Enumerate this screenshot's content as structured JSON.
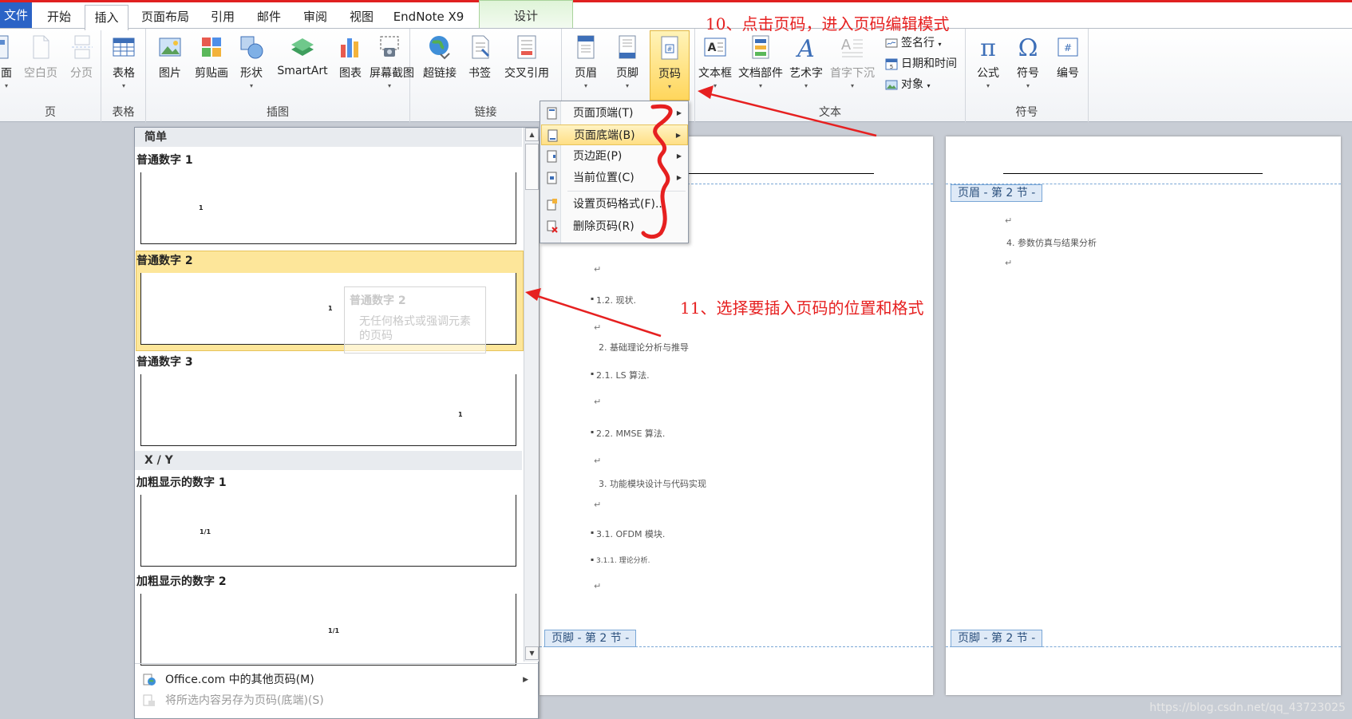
{
  "tabs": [
    {
      "label": "文件"
    },
    {
      "label": "开始"
    },
    {
      "label": "插入"
    },
    {
      "label": "页面布局"
    },
    {
      "label": "引用"
    },
    {
      "label": "邮件"
    },
    {
      "label": "审阅"
    },
    {
      "label": "视图"
    },
    {
      "label": "EndNote X9"
    },
    {
      "label": "设计"
    }
  ],
  "ribbon": {
    "groups": {
      "pages": "页",
      "tables": "表格",
      "illustrations": "插图",
      "links": "链接",
      "text": "文本",
      "symbols": "符号"
    },
    "buttons": {
      "cover": "面",
      "blank_page": "空白页",
      "page_break": "分页",
      "table": "表格",
      "picture": "图片",
      "clipart": "剪贴画",
      "shapes": "形状",
      "smartart": "SmartArt",
      "chart": "图表",
      "screenshot": "屏幕截图",
      "hyperlink": "超链接",
      "bookmark": "书签",
      "cross_ref": "交叉引用",
      "header": "页眉",
      "footer": "页脚",
      "page_number": "页码",
      "textbox": "文本框",
      "quick_parts": "文档部件",
      "wordart": "艺术字",
      "dropcap": "首字下沉",
      "signature": "签名行",
      "datetime": "日期和时间",
      "object": "对象",
      "equation": "公式",
      "symbol": "符号",
      "numbering": "编号"
    }
  },
  "menu": {
    "items": [
      {
        "label": "页面顶端(T)"
      },
      {
        "label": "页面底端(B)"
      },
      {
        "label": "页边距(P)"
      },
      {
        "label": "当前位置(C)"
      },
      {
        "label": "设置页码格式(F)..."
      },
      {
        "label": "删除页码(R)"
      }
    ]
  },
  "gallery": {
    "section_simple": "简单",
    "section_xy": "X / Y",
    "items": [
      {
        "title": "普通数字 1",
        "sample": "1"
      },
      {
        "title": "普通数字 2",
        "sample": "1"
      },
      {
        "title": "普通数字 3",
        "sample": "1"
      },
      {
        "title": "加粗显示的数字 1",
        "sample": "1/1"
      },
      {
        "title": "加粗显示的数字 2",
        "sample": "1/1"
      }
    ],
    "tooltip": {
      "title": "普通数字 2",
      "desc": "无任何格式或强调元素的页码"
    },
    "footer": {
      "more": "Office.com 中的其他页码(M)",
      "save": "将所选内容另存为页码(底端)(S)"
    }
  },
  "document": {
    "page1_lines": [
      "1.2. 现状.",
      "2. 基础理论分析与推导",
      "2.1. LS 算法.",
      "2.2. MMSE 算法.",
      "3. 功能模块设计与代码实现",
      "3.1. OFDM 模块.",
      "3.1.1. 理论分析."
    ],
    "page2_lines": [
      "4. 参数仿真与结果分析"
    ],
    "para_mark": "↵",
    "header_tag": "页眉 - 第 2 节 -",
    "footer_tag": "页脚 - 第 2 节 -"
  },
  "annotations": {
    "step10": "10、点击页码，进入页码编辑模式",
    "step11": "11、选择要插入页码的位置和格式"
  },
  "watermark": "https://blog.csdn.net/qq_43723025",
  "colors": {
    "accent_red": "#e62020",
    "file_tab": "#2b63c6",
    "hover": "#ffd65c"
  }
}
